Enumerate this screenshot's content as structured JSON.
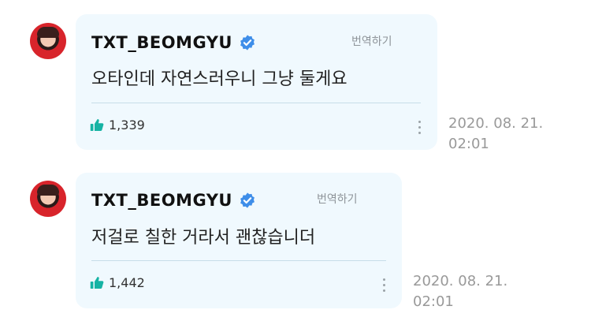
{
  "comments": [
    {
      "username": "TXT_BEOMGYU",
      "translate_label": "번역하기",
      "text": "오타인데 자연스러우니 그냥 둘게요",
      "likes": "1,339",
      "date": "2020. 08. 21.",
      "time": "02:01"
    },
    {
      "username": "TXT_BEOMGYU",
      "translate_label": "번역하기",
      "text": "저걸로 칠한 거라서 괜찮습니더",
      "likes": "1,442",
      "date": "2020. 08. 21.",
      "time": "02:01"
    }
  ],
  "colors": {
    "bubble_bg": "#f0f9fe",
    "verified_badge": "#3e8ee9",
    "like_icon": "#16b3a4",
    "avatar_bg": "#d8242b"
  },
  "icons": [
    "avatar",
    "verified-badge-icon",
    "thumbs-up-icon",
    "more-vert-icon"
  ]
}
